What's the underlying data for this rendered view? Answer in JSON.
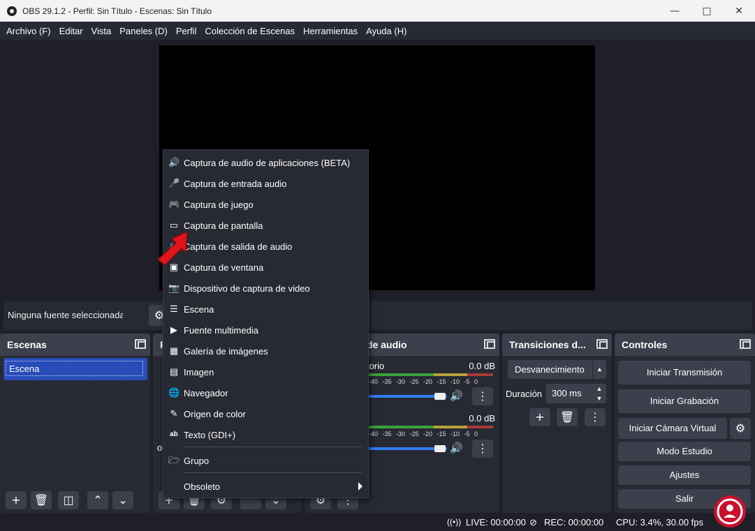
{
  "window": {
    "title": "OBS 29.1.2 - Perfil: Sin Título - Escenas: Sin Título"
  },
  "menubar": [
    "Archivo (F)",
    "Editar",
    "Vista",
    "Paneles (D)",
    "Perfil",
    "Colección de Escenas",
    "Herramientas",
    "Ayuda (H)"
  ],
  "source_bar": {
    "text": "Ninguna fuente seleccionada"
  },
  "scenes": {
    "title": "Escenas",
    "items": [
      "Escena"
    ]
  },
  "sources": {
    "title": "F",
    "partial_text": "o"
  },
  "mixer": {
    "title": "de audio",
    "channels": [
      {
        "name": "torio",
        "db": "0.0 dB"
      },
      {
        "name": "",
        "db": "0.0 dB"
      }
    ],
    "ticks": "-40 -35 -30 -25 -20 -15 -10 -5 0"
  },
  "transitions": {
    "title": "Transiciones d...",
    "selected": "Desvanecimiento",
    "duration_label": "Duración",
    "duration_value": "300 ms"
  },
  "controls": {
    "title": "Controles",
    "buttons": [
      "Iniciar Transmisión",
      "Iniciar Grabación",
      "Iniciar Cámara Virtual",
      "Modo Estudio",
      "Ajustes",
      "Salir"
    ]
  },
  "context_menu": {
    "items": [
      {
        "label": "Captura de audio de aplicaciones (BETA)",
        "icon": "app-audio-icon"
      },
      {
        "label": "Captura de entrada audio",
        "icon": "microphone-icon"
      },
      {
        "label": "Captura de juego",
        "icon": "gamepad-icon"
      },
      {
        "label": "Captura de pantalla",
        "icon": "monitor-icon"
      },
      {
        "label": "Captura de salida de audio",
        "icon": "speaker-icon"
      },
      {
        "label": "Captura de ventana",
        "icon": "window-icon"
      },
      {
        "label": "Dispositivo de captura de video",
        "icon": "camera-icon"
      },
      {
        "label": "Escena",
        "icon": "list-icon"
      },
      {
        "label": "Fuente multimedia",
        "icon": "play-icon"
      },
      {
        "label": "Galería de imágenes",
        "icon": "slideshow-icon"
      },
      {
        "label": "Imagen",
        "icon": "image-icon"
      },
      {
        "label": "Navegador",
        "icon": "globe-icon"
      },
      {
        "label": "Origen de color",
        "icon": "brush-icon"
      },
      {
        "label": "Texto (GDI+)",
        "icon": "text-icon"
      }
    ],
    "group": {
      "label": "Grupo",
      "icon": "folder-icon"
    },
    "deprecated": {
      "label": "Obsoleto"
    }
  },
  "status": {
    "live": "LIVE: 00:00:00",
    "rec": "REC: 00:00:00",
    "cpu": "CPU: 3.4%, 30.00 fps"
  },
  "colors": {
    "accent": "#284cb8",
    "panel": "#272a33",
    "header": "#3c404d",
    "arrow": "#e0141a"
  }
}
